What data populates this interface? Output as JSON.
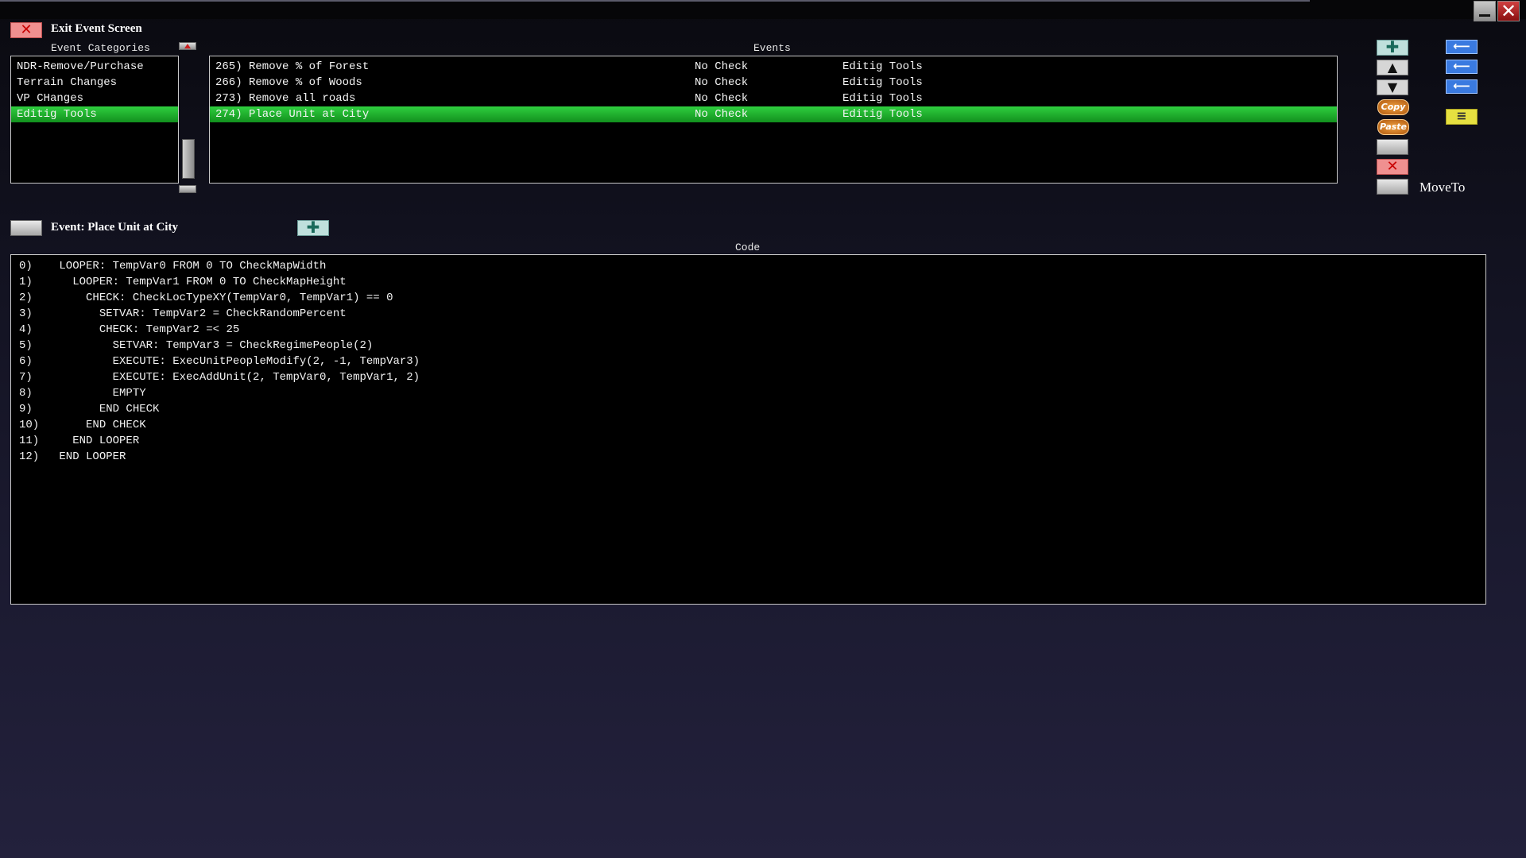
{
  "header": {
    "exit_label": "Exit Event Screen",
    "categories_title": "Event Categories",
    "events_title": "Events",
    "code_title": "Code"
  },
  "categories": [
    {
      "label": "NDR-Remove/Purchase",
      "selected": false
    },
    {
      "label": "Terrain Changes",
      "selected": false
    },
    {
      "label": "VP CHanges",
      "selected": false
    },
    {
      "label": "Editig Tools",
      "selected": true
    }
  ],
  "events": [
    {
      "label": "265) Remove % of Forest",
      "check": "No Check",
      "category": "Editig Tools",
      "selected": false
    },
    {
      "label": "266) Remove % of Woods",
      "check": "No Check",
      "category": "Editig Tools",
      "selected": false
    },
    {
      "label": "273) Remove all roads",
      "check": "No Check",
      "category": "Editig Tools",
      "selected": false
    },
    {
      "label": "274) Place Unit at City",
      "check": "No Check",
      "category": "Editig Tools",
      "selected": true
    }
  ],
  "right_toolbar": {
    "copy_label": "Copy",
    "paste_label": "Paste",
    "moveto_label": "MoveTo"
  },
  "event_detail": {
    "title": "Event: Place Unit at City"
  },
  "code_lines": [
    "0)    LOOPER: TempVar0 FROM 0 TO CheckMapWidth",
    "1)      LOOPER: TempVar1 FROM 0 TO CheckMapHeight",
    "2)        CHECK: CheckLocTypeXY(TempVar0, TempVar1) == 0",
    "3)          SETVAR: TempVar2 = CheckRandomPercent",
    "4)          CHECK: TempVar2 =< 25",
    "5)            SETVAR: TempVar3 = CheckRegimePeople(2)",
    "6)            EXECUTE: ExecUnitPeopleModify(2, -1, TempVar3)",
    "7)            EXECUTE: ExecAddUnit(2, TempVar0, TempVar1, 2)",
    "8)            EMPTY",
    "9)          END CHECK",
    "10)       END CHECK",
    "11)     END LOOPER",
    "12)   END LOOPER"
  ],
  "colors": {
    "selection_green": "#22b22e",
    "accent_blue": "#3a7ae0",
    "close_red": "#c80000"
  }
}
